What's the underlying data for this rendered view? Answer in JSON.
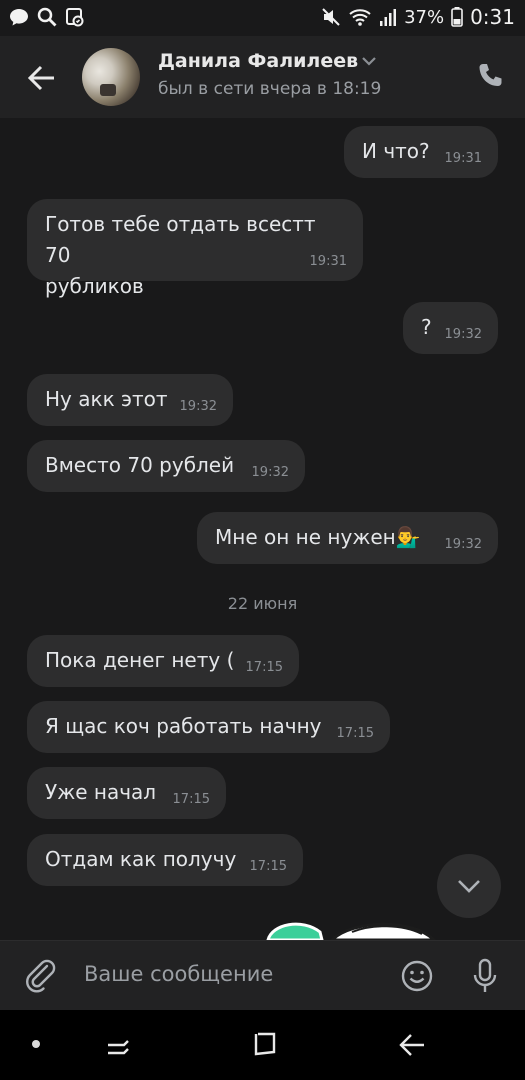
{
  "status_bar": {
    "battery": "37%",
    "time": "0:31",
    "icons": [
      "chat-bubble-icon",
      "search-icon",
      "cast-icon",
      "mute-icon",
      "wifi-icon",
      "signal-icon",
      "battery-icon"
    ]
  },
  "header": {
    "contact_name": "Данила Фалилеев",
    "last_seen": "был в сети вчера в 18:19"
  },
  "messages": [
    {
      "text": "И что?",
      "time": "19:31",
      "outgoing": true
    },
    {
      "text_line1": "Готов тебе отдать всестт 70",
      "text_line2": "рубликов",
      "time": "19:31",
      "outgoing": false
    },
    {
      "text": "?",
      "time": "19:32",
      "outgoing": true
    },
    {
      "text": "Ну акк этот",
      "time": "19:32",
      "outgoing": false
    },
    {
      "text": "Вместо 70 рублей",
      "time": "19:32",
      "outgoing": false
    },
    {
      "text": "Мне он не нужен",
      "emoji": "💁‍♂️",
      "time": "19:32",
      "outgoing": true
    },
    {
      "text": "Пока денег нету (",
      "time": "17:15",
      "outgoing": false
    },
    {
      "text": "Я щас коч работать начну",
      "time": "17:15",
      "outgoing": false
    },
    {
      "text": "Уже начал",
      "time": "17:15",
      "outgoing": false
    },
    {
      "text": "Отдам как получу",
      "time": "17:15",
      "outgoing": false
    }
  ],
  "date_separator": "22 июня",
  "composer": {
    "placeholder": "Ваше сообщение"
  },
  "colors": {
    "background": "#19191a",
    "header": "#222223",
    "bubble": "#2d2d2e",
    "sticker_accent": "#3ccf9a"
  }
}
